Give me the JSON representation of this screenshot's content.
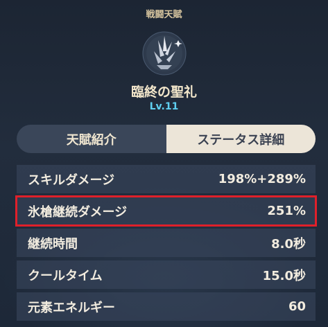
{
  "header": {
    "category": "戦闘天賦",
    "talent_name": "臨終の聖礼",
    "level": "Lv.11",
    "icon": "ice-shards-icon"
  },
  "tabs": [
    {
      "label": "天賦紹介",
      "active": false
    },
    {
      "label": "ステータス詳細",
      "active": true
    }
  ],
  "stats": [
    {
      "label": "スキルダメージ",
      "value": "198%+289%"
    },
    {
      "label": "氷槍継続ダメージ",
      "value": "251%",
      "highlighted": true
    },
    {
      "label": "継続時間",
      "value": "8.0秒"
    },
    {
      "label": "クールタイム",
      "value": "15.0秒"
    },
    {
      "label": "元素エネルギー",
      "value": "60"
    }
  ],
  "colors": {
    "highlight": "#e0202a",
    "level_text": "#5fd0f1",
    "active_tab_bg": "#ece5d8"
  }
}
